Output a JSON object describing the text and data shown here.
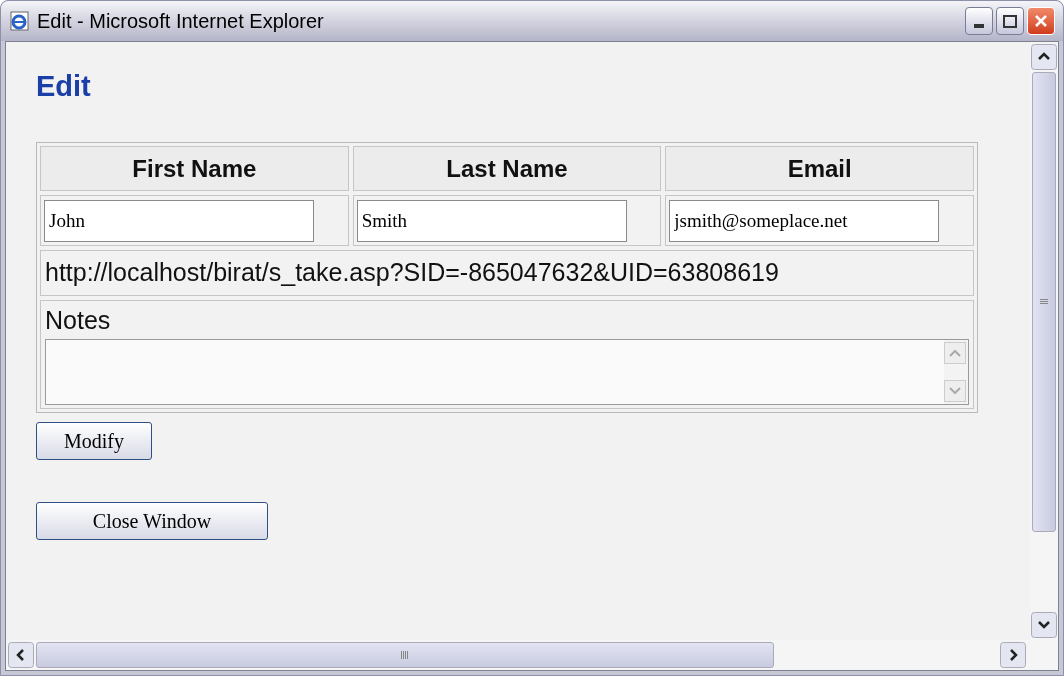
{
  "window": {
    "title": "Edit - Microsoft Internet Explorer"
  },
  "heading": "Edit",
  "table": {
    "columns": [
      "First Name",
      "Last Name",
      "Email"
    ],
    "fields": [
      {
        "value": "John"
      },
      {
        "value": "Smith"
      },
      {
        "value": "jsmith@someplace.net"
      }
    ],
    "url": "http://localhost/birat/s_take.asp?SID=-865047632&UID=63808619",
    "notes": {
      "label": "Notes"
    }
  },
  "buttons": [
    {
      "label": "Modify"
    },
    {
      "label": "Close Window"
    }
  ]
}
